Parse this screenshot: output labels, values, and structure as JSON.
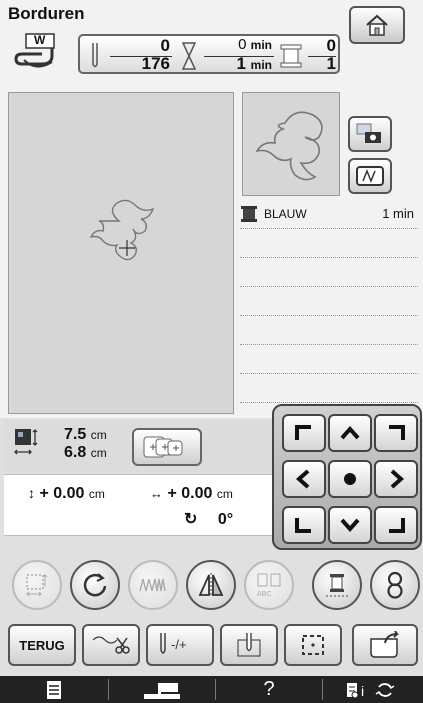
{
  "header": {
    "title": "Borduren",
    "presser_foot": "W",
    "stitch_current": "0",
    "stitch_total": "176",
    "time_current": "0",
    "time_total": "1",
    "time_unit": "min",
    "color_current": "0",
    "color_total": "1"
  },
  "colors": {
    "accent": "#333333",
    "thread": "#333333",
    "panel_bg": "#d6d6d6"
  },
  "thread_list": [
    {
      "name": "BLAUW",
      "time": "1 min"
    }
  ],
  "size": {
    "width": "7.5",
    "height": "6.8",
    "unit": "cm"
  },
  "move": {
    "vertical": "+ 0.00",
    "horizontal": "+ 0.00",
    "unit": "cm",
    "rotation": "0°"
  },
  "buttons": {
    "back_label": "TERUG"
  },
  "status": {
    "help": "?"
  }
}
